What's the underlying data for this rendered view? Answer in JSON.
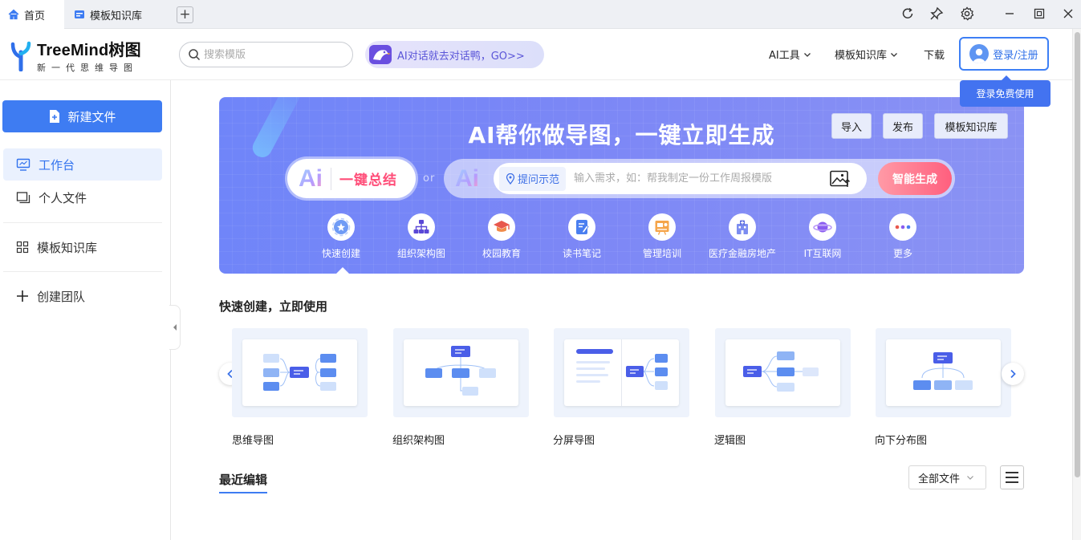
{
  "tabs": [
    {
      "label": "首页",
      "active": true
    },
    {
      "label": "模板知识库",
      "active": false
    }
  ],
  "header": {
    "logo_name": "TreeMind树图",
    "logo_tagline": "新一代思维导图",
    "search_placeholder": "搜索模版",
    "ai_promo": "AI对话就去对话鸭，GO>>",
    "nav": [
      {
        "label": "AI工具",
        "dropdown": true
      },
      {
        "label": "模板知识库",
        "dropdown": true
      },
      {
        "label": "下载",
        "dropdown": false
      }
    ],
    "login_label": "登录/注册",
    "login_tip": "登录免费使用"
  },
  "sidebar": {
    "new_file": "新建文件",
    "items": [
      {
        "label": "工作台",
        "icon": "monitor-icon",
        "active": true
      },
      {
        "label": "个人文件",
        "icon": "folder-icon",
        "active": false
      },
      {
        "label": "模板知识库",
        "icon": "grid-icon",
        "active": false
      },
      {
        "label": "创建团队",
        "icon": "plus-icon",
        "active": false
      }
    ]
  },
  "banner": {
    "title": "AI帮你做导图，一键立即生成",
    "buttons": [
      "导入",
      "发布",
      "模板知识库"
    ],
    "ai_glyph": "Ai",
    "summary_label": "一键总结",
    "or_label": "or",
    "hint_tag": "提问示范",
    "prompt_placeholder": "输入需求，如：帮我制定一份工作周报模版",
    "generate_label": "智能生成",
    "categories": [
      {
        "label": "快速创建",
        "icon": "quick-create-icon",
        "selected": true
      },
      {
        "label": "组织架构图",
        "icon": "org-chart-icon"
      },
      {
        "label": "校园教育",
        "icon": "graduation-cap-icon"
      },
      {
        "label": "读书笔记",
        "icon": "notebook-icon"
      },
      {
        "label": "管理培训",
        "icon": "training-board-icon"
      },
      {
        "label": "医疗金融房地产",
        "icon": "building-icon"
      },
      {
        "label": "IT互联网",
        "icon": "planet-icon"
      },
      {
        "label": "更多",
        "icon": "more-dots-icon"
      }
    ]
  },
  "quick_create": {
    "title": "快速创建，立即使用",
    "templates": [
      {
        "label": "思维导图",
        "kind": "mindmap"
      },
      {
        "label": "组织架构图",
        "kind": "org"
      },
      {
        "label": "分屏导图",
        "kind": "split"
      },
      {
        "label": "逻辑图",
        "kind": "logic"
      },
      {
        "label": "向下分布图",
        "kind": "down"
      }
    ]
  },
  "recent": {
    "title": "最近编辑",
    "filter_value": "全部文件"
  },
  "colors": {
    "accent": "#3e7cf2",
    "banner_start": "#6f85f9",
    "generate_end": "#ff5f7e"
  }
}
